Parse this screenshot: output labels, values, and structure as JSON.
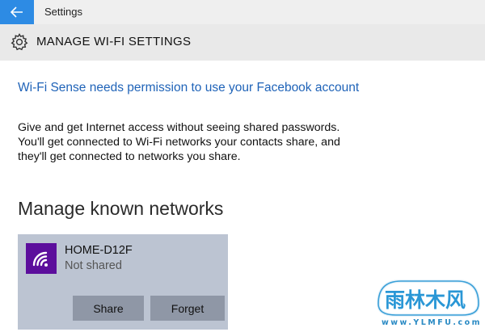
{
  "titlebar": {
    "app_title": "Settings",
    "back_icon": "arrow-left-icon",
    "back_color": "#2d8be4"
  },
  "header": {
    "icon": "gear-icon",
    "title": "MANAGE WI-FI SETTINGS"
  },
  "main": {
    "permission_link": "Wi-Fi Sense needs permission to use your Facebook account",
    "description_lines": [
      "Give and get Internet access without seeing shared passwords.",
      "You'll get connected to Wi-Fi networks your contacts share, and",
      "they'll get connected to networks you share."
    ],
    "section_title": "Manage known networks",
    "networks": [
      {
        "name": "HOME-D12F",
        "status": "Not shared",
        "icon": "wifi-icon",
        "tile_color": "#5c0e9c",
        "share_label": "Share",
        "forget_label": "Forget"
      }
    ]
  },
  "watermark": {
    "text": "雨林木风",
    "url_text": "www.YLMFU.com"
  },
  "colors": {
    "accent": "#2d8be4",
    "link": "#1f63b8",
    "card_background": "#bcc4d2",
    "button_background": "#8f97a6"
  }
}
